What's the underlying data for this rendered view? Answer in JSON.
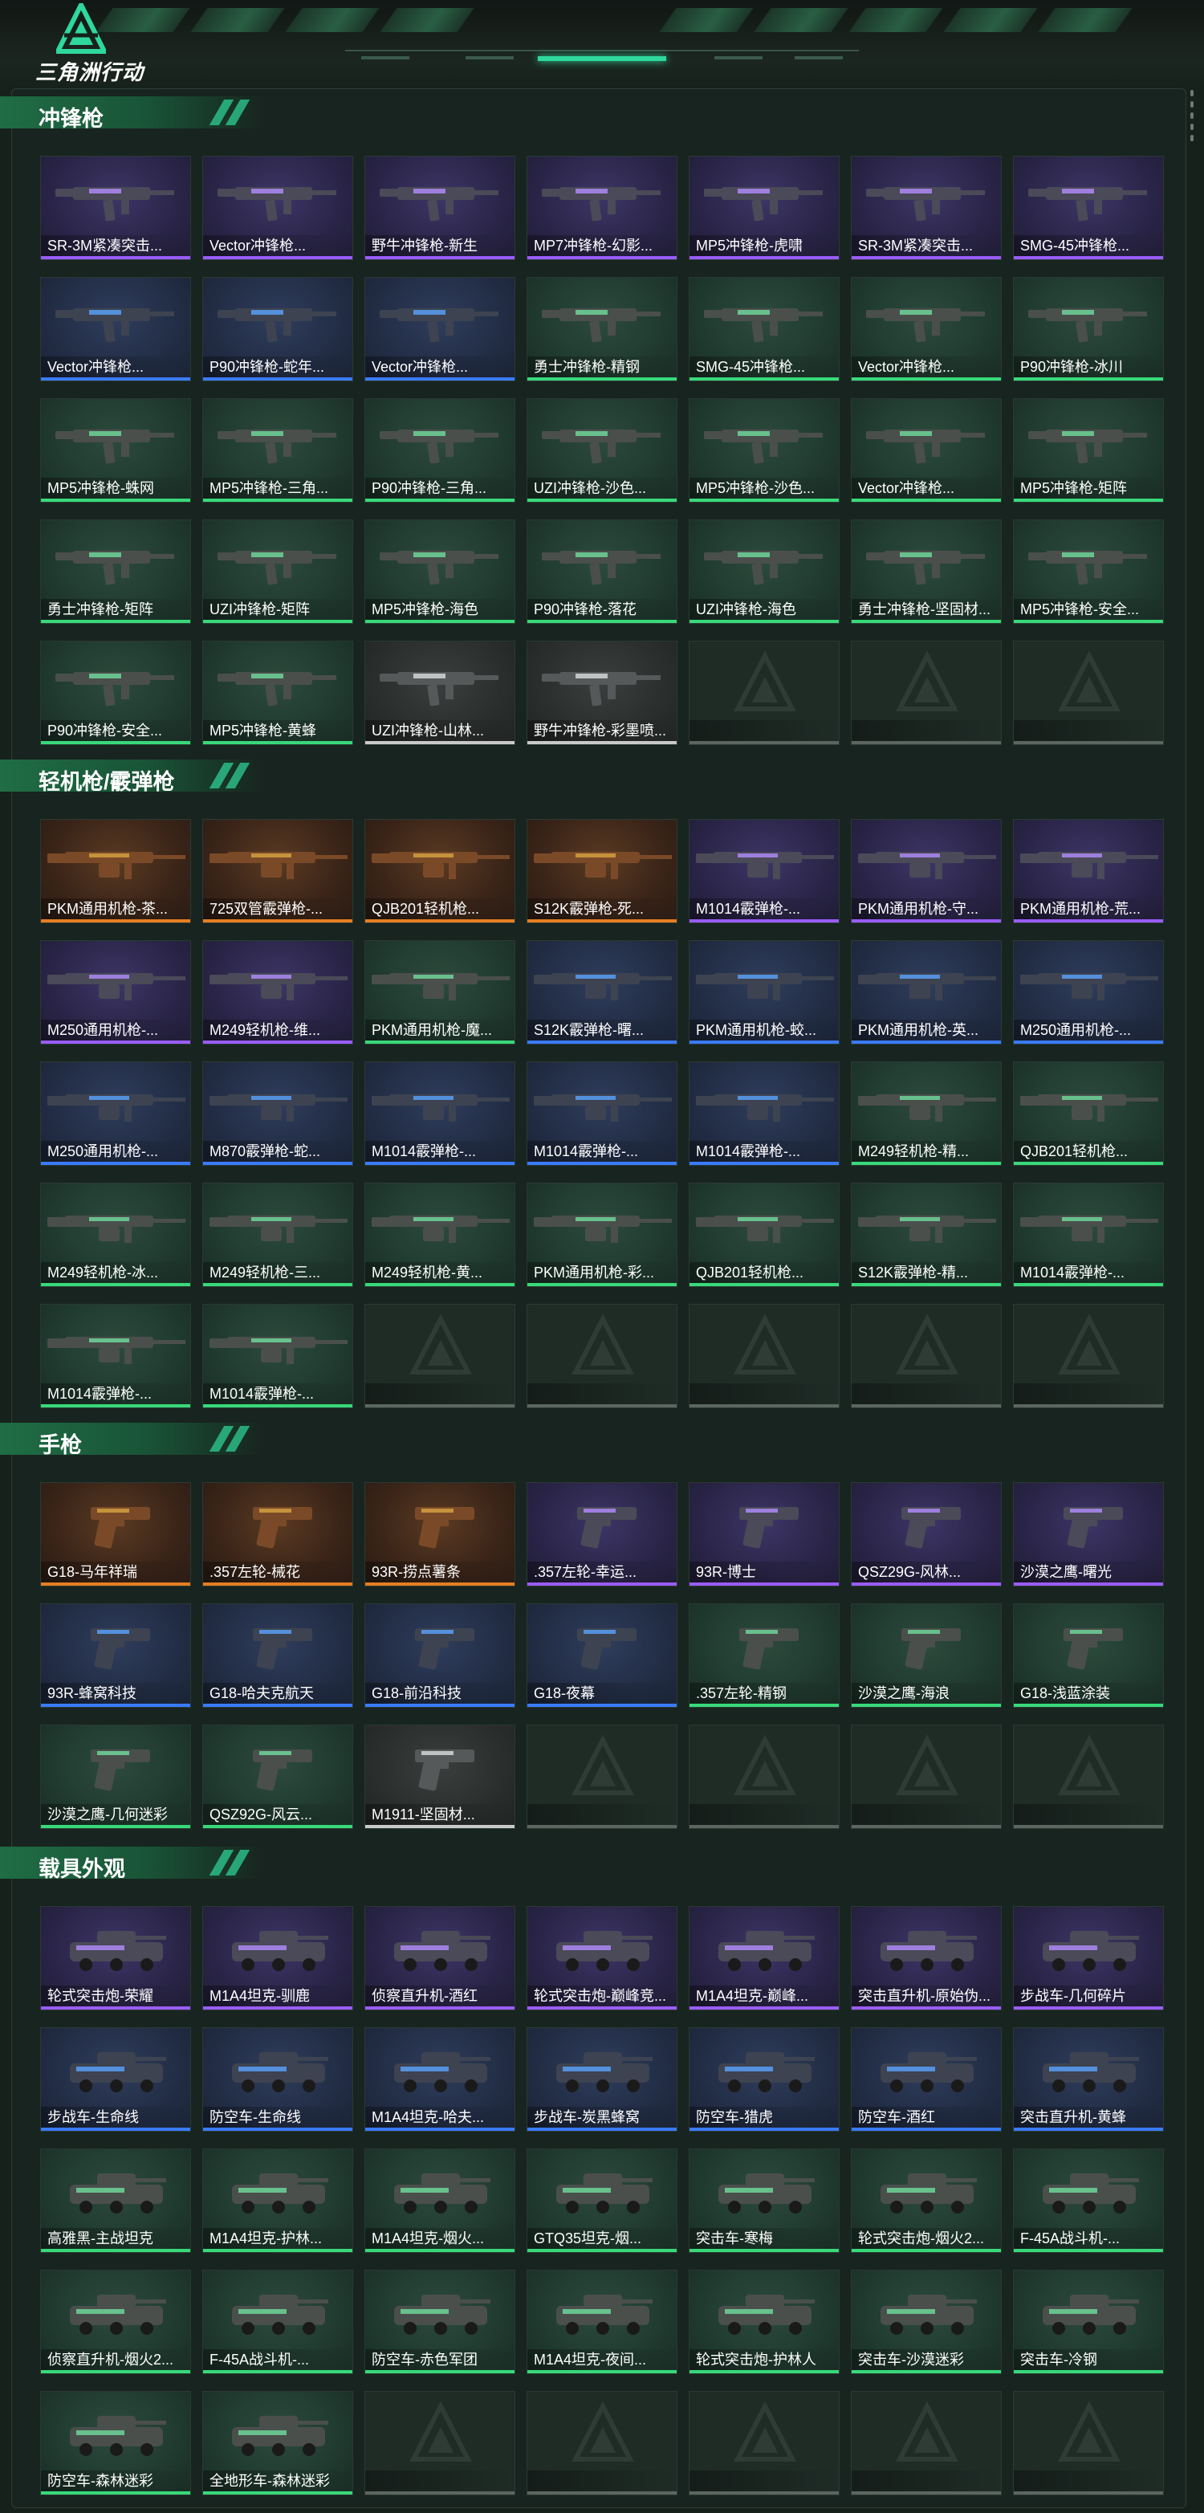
{
  "app": {
    "title": "三角洲行动"
  },
  "colors": {
    "accent": "#2fd89c",
    "rarity_gold": "#e67e22",
    "rarity_purple": "#9a5cff",
    "rarity_blue": "#3a7bff",
    "rarity_green": "#38d97a",
    "rarity_white": "#c9c9c9"
  },
  "sections": [
    {
      "title": "冲锋枪",
      "icon": "smg-icon",
      "items": [
        {
          "name": "SR-3M紧凑突击...",
          "rarity": "purple"
        },
        {
          "name": "Vector冲锋枪...",
          "rarity": "purple"
        },
        {
          "name": "野牛冲锋枪-新生",
          "rarity": "purple"
        },
        {
          "name": "MP7冲锋枪-幻影...",
          "rarity": "purple"
        },
        {
          "name": "MP5冲锋枪-虎啸",
          "rarity": "purple"
        },
        {
          "name": "SR-3M紧凑突击...",
          "rarity": "purple"
        },
        {
          "name": "SMG-45冲锋枪...",
          "rarity": "purple"
        },
        {
          "name": "Vector冲锋枪...",
          "rarity": "blue"
        },
        {
          "name": "P90冲锋枪-蛇年...",
          "rarity": "blue"
        },
        {
          "name": "Vector冲锋枪...",
          "rarity": "blue"
        },
        {
          "name": "勇士冲锋枪-精钢",
          "rarity": "green"
        },
        {
          "name": "SMG-45冲锋枪...",
          "rarity": "green"
        },
        {
          "name": "Vector冲锋枪...",
          "rarity": "green"
        },
        {
          "name": "P90冲锋枪-冰川",
          "rarity": "green"
        },
        {
          "name": "MP5冲锋枪-蛛网",
          "rarity": "green"
        },
        {
          "name": "MP5冲锋枪-三角...",
          "rarity": "green"
        },
        {
          "name": "P90冲锋枪-三角...",
          "rarity": "green"
        },
        {
          "name": "UZI冲锋枪-沙色...",
          "rarity": "green"
        },
        {
          "name": "MP5冲锋枪-沙色...",
          "rarity": "green"
        },
        {
          "name": "Vector冲锋枪...",
          "rarity": "green"
        },
        {
          "name": "MP5冲锋枪-矩阵",
          "rarity": "green"
        },
        {
          "name": "勇士冲锋枪-矩阵",
          "rarity": "green"
        },
        {
          "name": "UZI冲锋枪-矩阵",
          "rarity": "green"
        },
        {
          "name": "MP5冲锋枪-海色",
          "rarity": "green"
        },
        {
          "name": "P90冲锋枪-落花",
          "rarity": "green"
        },
        {
          "name": "UZI冲锋枪-海色",
          "rarity": "green"
        },
        {
          "name": "勇士冲锋枪-坚固材...",
          "rarity": "green"
        },
        {
          "name": "MP5冲锋枪-安全...",
          "rarity": "green"
        },
        {
          "name": "P90冲锋枪-安全...",
          "rarity": "green"
        },
        {
          "name": "MP5冲锋枪-黄蜂",
          "rarity": "green"
        },
        {
          "name": "UZI冲锋枪-山林...",
          "rarity": "white"
        },
        {
          "name": "野牛冲锋枪-彩墨喷...",
          "rarity": "white"
        },
        {
          "name": "",
          "rarity": "empty"
        },
        {
          "name": "",
          "rarity": "empty"
        },
        {
          "name": "",
          "rarity": "empty"
        }
      ]
    },
    {
      "title": "轻机枪/霰弹枪",
      "icon": "lmg-icon",
      "items": [
        {
          "name": "PKM通用机枪-茶...",
          "rarity": "gold"
        },
        {
          "name": "725双管霰弹枪-...",
          "rarity": "gold"
        },
        {
          "name": "QJB201轻机枪...",
          "rarity": "gold"
        },
        {
          "name": "S12K霰弹枪-死...",
          "rarity": "gold"
        },
        {
          "name": "M1014霰弹枪-...",
          "rarity": "purple"
        },
        {
          "name": "PKM通用机枪-守...",
          "rarity": "purple"
        },
        {
          "name": "PKM通用机枪-荒...",
          "rarity": "purple"
        },
        {
          "name": "M250通用机枪-...",
          "rarity": "purple"
        },
        {
          "name": "M249轻机枪-维...",
          "rarity": "purple"
        },
        {
          "name": "PKM通用机枪-魔...",
          "rarity": "green"
        },
        {
          "name": "S12K霰弹枪-曙...",
          "rarity": "blue"
        },
        {
          "name": "PKM通用机枪-蛟...",
          "rarity": "blue"
        },
        {
          "name": "PKM通用机枪-英...",
          "rarity": "blue"
        },
        {
          "name": "M250通用机枪-...",
          "rarity": "blue"
        },
        {
          "name": "M250通用机枪-...",
          "rarity": "blue"
        },
        {
          "name": "M870霰弹枪-蛇...",
          "rarity": "blue"
        },
        {
          "name": "M1014霰弹枪-...",
          "rarity": "blue"
        },
        {
          "name": "M1014霰弹枪-...",
          "rarity": "blue"
        },
        {
          "name": "M1014霰弹枪-...",
          "rarity": "blue"
        },
        {
          "name": "M249轻机枪-精...",
          "rarity": "green"
        },
        {
          "name": "QJB201轻机枪...",
          "rarity": "green"
        },
        {
          "name": "M249轻机枪-冰...",
          "rarity": "green"
        },
        {
          "name": "M249轻机枪-三...",
          "rarity": "green"
        },
        {
          "name": "M249轻机枪-黄...",
          "rarity": "green"
        },
        {
          "name": "PKM通用机枪-彩...",
          "rarity": "green"
        },
        {
          "name": "QJB201轻机枪...",
          "rarity": "green"
        },
        {
          "name": "S12K霰弹枪-精...",
          "rarity": "green"
        },
        {
          "name": "M1014霰弹枪-...",
          "rarity": "green"
        },
        {
          "name": "M1014霰弹枪-...",
          "rarity": "green"
        },
        {
          "name": "M1014霰弹枪-...",
          "rarity": "green"
        },
        {
          "name": "",
          "rarity": "empty"
        },
        {
          "name": "",
          "rarity": "empty"
        },
        {
          "name": "",
          "rarity": "empty"
        },
        {
          "name": "",
          "rarity": "empty"
        },
        {
          "name": "",
          "rarity": "empty"
        }
      ]
    },
    {
      "title": "手枪",
      "icon": "pistol-icon",
      "items": [
        {
          "name": "G18-马年祥瑞",
          "rarity": "gold"
        },
        {
          "name": ".357左轮-械花",
          "rarity": "gold"
        },
        {
          "name": "93R-捞点薯条",
          "rarity": "gold"
        },
        {
          "name": ".357左轮-幸运...",
          "rarity": "purple"
        },
        {
          "name": "93R-博士",
          "rarity": "purple"
        },
        {
          "name": "QSZ29G-风林...",
          "rarity": "purple"
        },
        {
          "name": "沙漠之鹰-曙光",
          "rarity": "purple"
        },
        {
          "name": "93R-蜂窝科技",
          "rarity": "blue"
        },
        {
          "name": "G18-哈夫克航天",
          "rarity": "blue"
        },
        {
          "name": "G18-前沿科技",
          "rarity": "blue"
        },
        {
          "name": "G18-夜幕",
          "rarity": "blue"
        },
        {
          "name": ".357左轮-精钢",
          "rarity": "green"
        },
        {
          "name": "沙漠之鹰-海浪",
          "rarity": "green"
        },
        {
          "name": "G18-浅蓝涂装",
          "rarity": "green"
        },
        {
          "name": "沙漠之鹰-几何迷彩",
          "rarity": "green"
        },
        {
          "name": "QSZ92G-风云...",
          "rarity": "green"
        },
        {
          "name": "M1911-坚固材...",
          "rarity": "white"
        },
        {
          "name": "",
          "rarity": "empty"
        },
        {
          "name": "",
          "rarity": "empty"
        },
        {
          "name": "",
          "rarity": "empty"
        },
        {
          "name": "",
          "rarity": "empty"
        }
      ]
    },
    {
      "title": "载具外观",
      "icon": "vehicle-icon",
      "items": [
        {
          "name": "轮式突击炮-荣耀",
          "rarity": "purple"
        },
        {
          "name": "M1A4坦克-驯鹿",
          "rarity": "purple"
        },
        {
          "name": "侦察直升机-酒红",
          "rarity": "purple"
        },
        {
          "name": "轮式突击炮-巅峰竞...",
          "rarity": "purple"
        },
        {
          "name": "M1A4坦克-巅峰...",
          "rarity": "purple"
        },
        {
          "name": "突击直升机-原始伪...",
          "rarity": "purple"
        },
        {
          "name": "步战车-几何碎片",
          "rarity": "purple"
        },
        {
          "name": "步战车-生命线",
          "rarity": "blue"
        },
        {
          "name": "防空车-生命线",
          "rarity": "blue"
        },
        {
          "name": "M1A4坦克-哈夫...",
          "rarity": "blue"
        },
        {
          "name": "步战车-炭黑蜂窝",
          "rarity": "blue"
        },
        {
          "name": "防空车-猎虎",
          "rarity": "blue"
        },
        {
          "name": "防空车-酒红",
          "rarity": "blue"
        },
        {
          "name": "突击直升机-黄蜂",
          "rarity": "blue"
        },
        {
          "name": "高雅黑-主战坦克",
          "rarity": "green"
        },
        {
          "name": "M1A4坦克-护林...",
          "rarity": "green"
        },
        {
          "name": "M1A4坦克-烟火...",
          "rarity": "green"
        },
        {
          "name": "GTQ35坦克-烟...",
          "rarity": "green"
        },
        {
          "name": "突击车-寒梅",
          "rarity": "green"
        },
        {
          "name": "轮式突击炮-烟火2...",
          "rarity": "green"
        },
        {
          "name": "F-45A战斗机-...",
          "rarity": "green"
        },
        {
          "name": "侦察直升机-烟火2...",
          "rarity": "green"
        },
        {
          "name": "F-45A战斗机-...",
          "rarity": "green"
        },
        {
          "name": "防空车-赤色军团",
          "rarity": "green"
        },
        {
          "name": "M1A4坦克-夜间...",
          "rarity": "green"
        },
        {
          "name": "轮式突击炮-护林人",
          "rarity": "green"
        },
        {
          "name": "突击车-沙漠迷彩",
          "rarity": "green"
        },
        {
          "name": "突击车-冷钢",
          "rarity": "green"
        },
        {
          "name": "防空车-森林迷彩",
          "rarity": "green"
        },
        {
          "name": "全地形车-森林迷彩",
          "rarity": "green"
        },
        {
          "name": "",
          "rarity": "empty"
        },
        {
          "name": "",
          "rarity": "empty"
        },
        {
          "name": "",
          "rarity": "empty"
        },
        {
          "name": "",
          "rarity": "empty"
        },
        {
          "name": "",
          "rarity": "empty"
        }
      ]
    }
  ]
}
